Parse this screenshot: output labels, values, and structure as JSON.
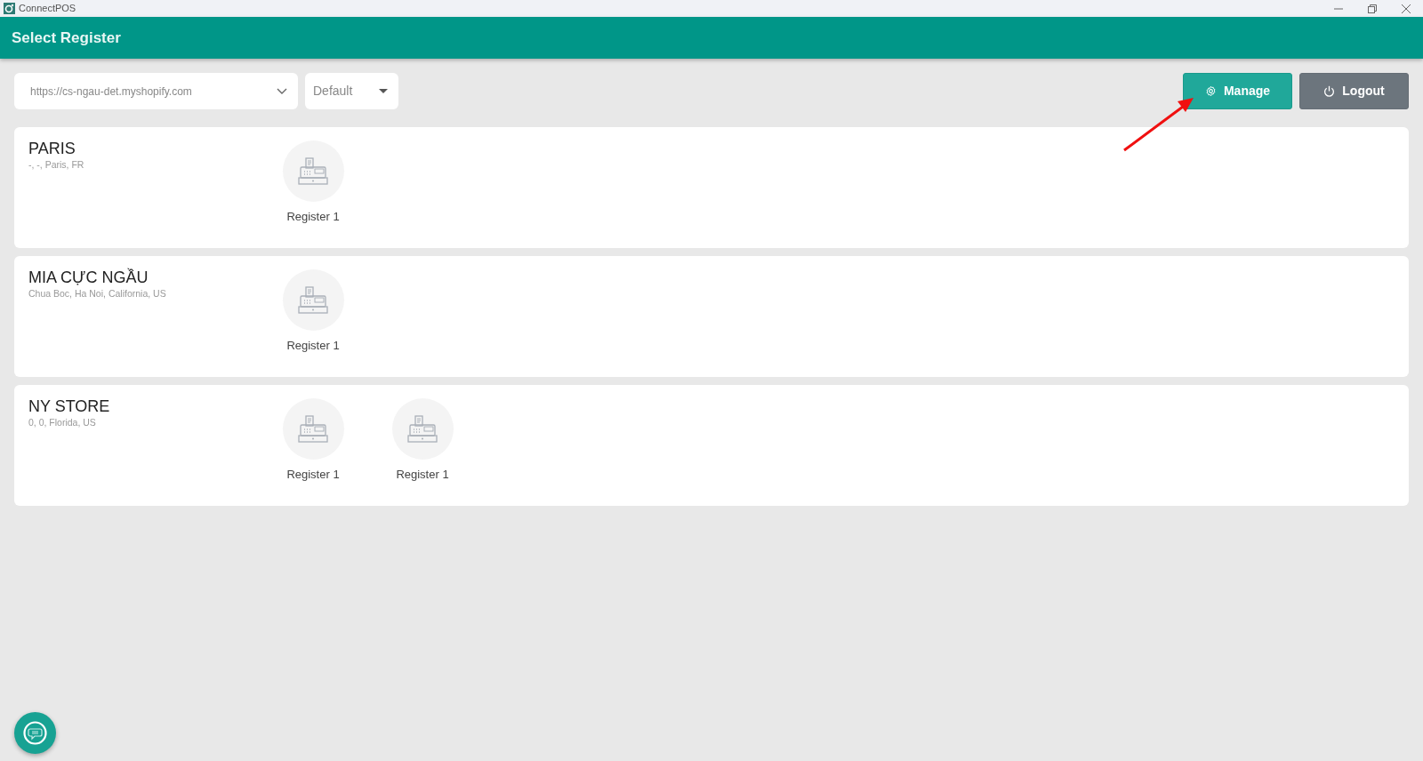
{
  "window": {
    "title": "ConnectPOS"
  },
  "header": {
    "title": "Select Register"
  },
  "toolbar": {
    "store_url": "https://cs-ngau-det.myshopify.com",
    "outlet": "Default",
    "buttons": [
      {
        "kind": "manage",
        "label": "Manage"
      },
      {
        "kind": "logout",
        "label": "Logout"
      }
    ]
  },
  "stores": [
    {
      "name": "PARIS",
      "address": "-, -, Paris, FR",
      "registers": [
        {
          "label": "Register 1"
        }
      ]
    },
    {
      "name": "MIA CỰC NGẦU",
      "address": "Chua Boc, Ha Noi, California, US",
      "registers": [
        {
          "label": "Register 1"
        }
      ]
    },
    {
      "name": "NY STORE",
      "address": "0, 0, Florida, US",
      "registers": [
        {
          "label": "Register 1"
        },
        {
          "label": "Register 1"
        }
      ]
    }
  ]
}
